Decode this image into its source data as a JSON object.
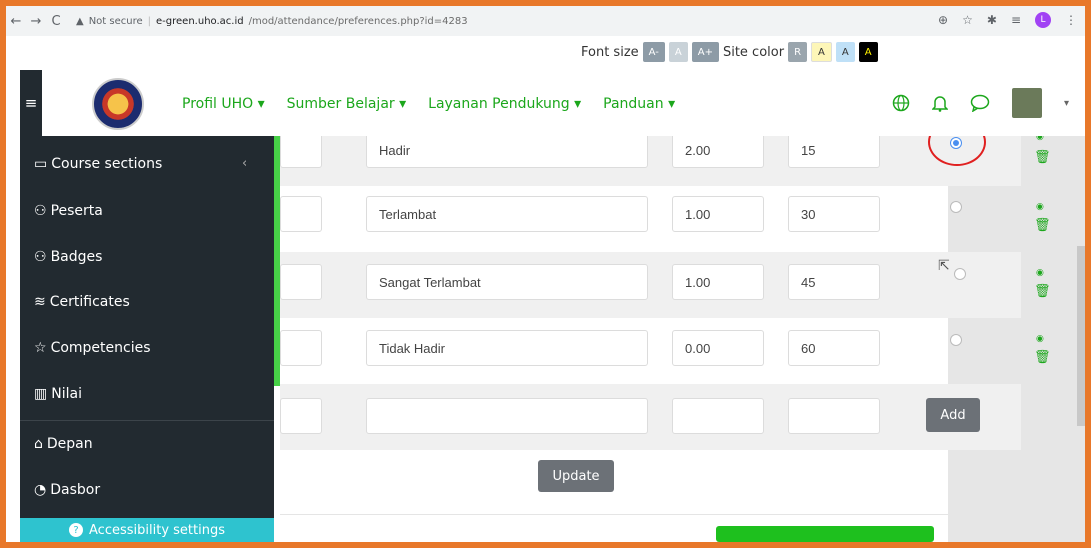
{
  "browser": {
    "url_warning": "Not secure",
    "url_host": "e-green.uho.ac.id",
    "url_path": "/mod/attendance/preferences.php?id=4283",
    "profile_letter": "L"
  },
  "fontbar": {
    "font_size_label": "Font size",
    "a_minus": "A-",
    "a_normal": "A",
    "a_plus": "A+",
    "site_color_label": "Site color",
    "color_r": "R",
    "color_y": "A",
    "color_b": "A",
    "color_k": "A"
  },
  "header": {
    "menu": [
      "Profil UHO ▾",
      "Sumber Belajar ▾",
      "Layanan Pendukung ▾",
      "Panduan ▾"
    ]
  },
  "sidebar": {
    "items": [
      {
        "label": "Course sections",
        "icon": "folder-icon"
      },
      {
        "label": "Peserta",
        "icon": "users-icon"
      },
      {
        "label": "Badges",
        "icon": "badge-icon"
      },
      {
        "label": "Certificates",
        "icon": "certificate-icon"
      },
      {
        "label": "Competencies",
        "icon": "star-icon"
      },
      {
        "label": "Nilai",
        "icon": "book-icon"
      },
      {
        "label": "Depan",
        "icon": "home-icon"
      },
      {
        "label": "Dasbor",
        "icon": "dashboard-icon"
      }
    ],
    "accessibility": "Accessibility settings"
  },
  "table": {
    "rows": [
      {
        "description": "Hadir",
        "grade": "2.00",
        "minutes": "15",
        "selected": true
      },
      {
        "description": "Terlambat",
        "grade": "1.00",
        "minutes": "30",
        "selected": false
      },
      {
        "description": "Sangat Terlambat",
        "grade": "1.00",
        "minutes": "45",
        "selected": false
      },
      {
        "description": "Tidak Hadir",
        "grade": "0.00",
        "minutes": "60",
        "selected": false
      }
    ],
    "add_label": "Add",
    "update_label": "Update"
  }
}
